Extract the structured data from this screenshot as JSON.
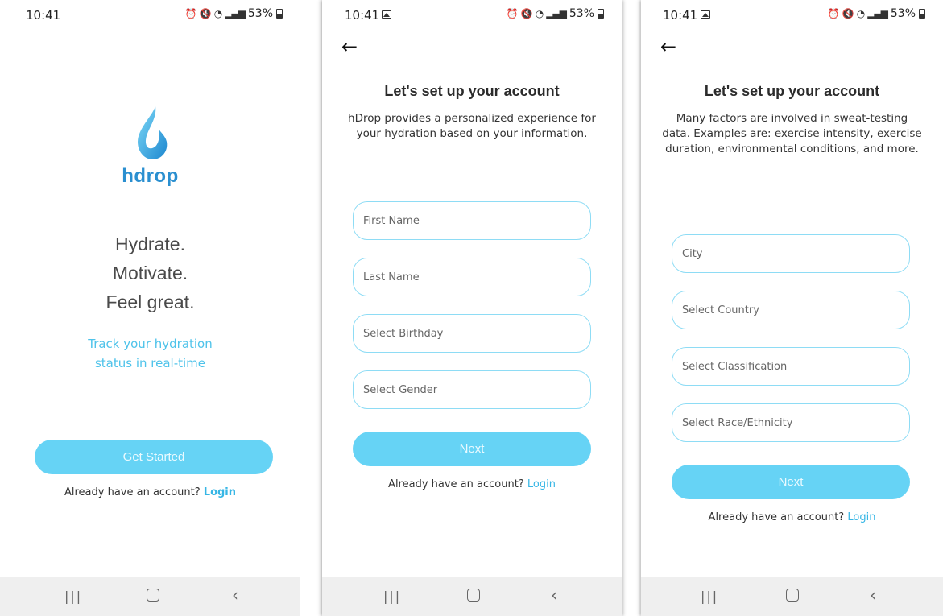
{
  "status": {
    "time": "10:41",
    "battery": "53%"
  },
  "screen1": {
    "brand": "hdrop",
    "tagline": [
      "Hydrate.",
      "Motivate.",
      "Feel great."
    ],
    "subtag": [
      "Track your hydration",
      "status in real-time"
    ],
    "cta": "Get Started",
    "login_prompt": "Already have an account?",
    "login_link": "Login"
  },
  "screen2": {
    "title": "Let's set up your account",
    "desc": "hDrop provides a personalized experience for your hydration based on your information.",
    "fields": [
      "First Name",
      "Last Name",
      "Select Birthday",
      "Select Gender"
    ],
    "next": "Next",
    "login_prompt": "Already have an account?",
    "login_link": "Login"
  },
  "screen3": {
    "title": "Let's set up your account",
    "desc": "Many factors are involved in sweat-testing data. Examples are: exercise intensity, exercise duration, environmental conditions, and more.",
    "fields": [
      "City",
      "Select Country",
      "Select Classification",
      "Select Race/Ethnicity"
    ],
    "next": "Next",
    "login_prompt": "Already have an account?",
    "login_link": "Login"
  },
  "nav": {
    "recent_icon": "recent-apps-icon",
    "home_icon": "home-icon",
    "back_icon": "back-nav-icon"
  },
  "colors": {
    "accent": "#66d3f5",
    "link": "#36b6e5",
    "field_border": "#8edcf5",
    "brand": "#2a8fd0"
  }
}
